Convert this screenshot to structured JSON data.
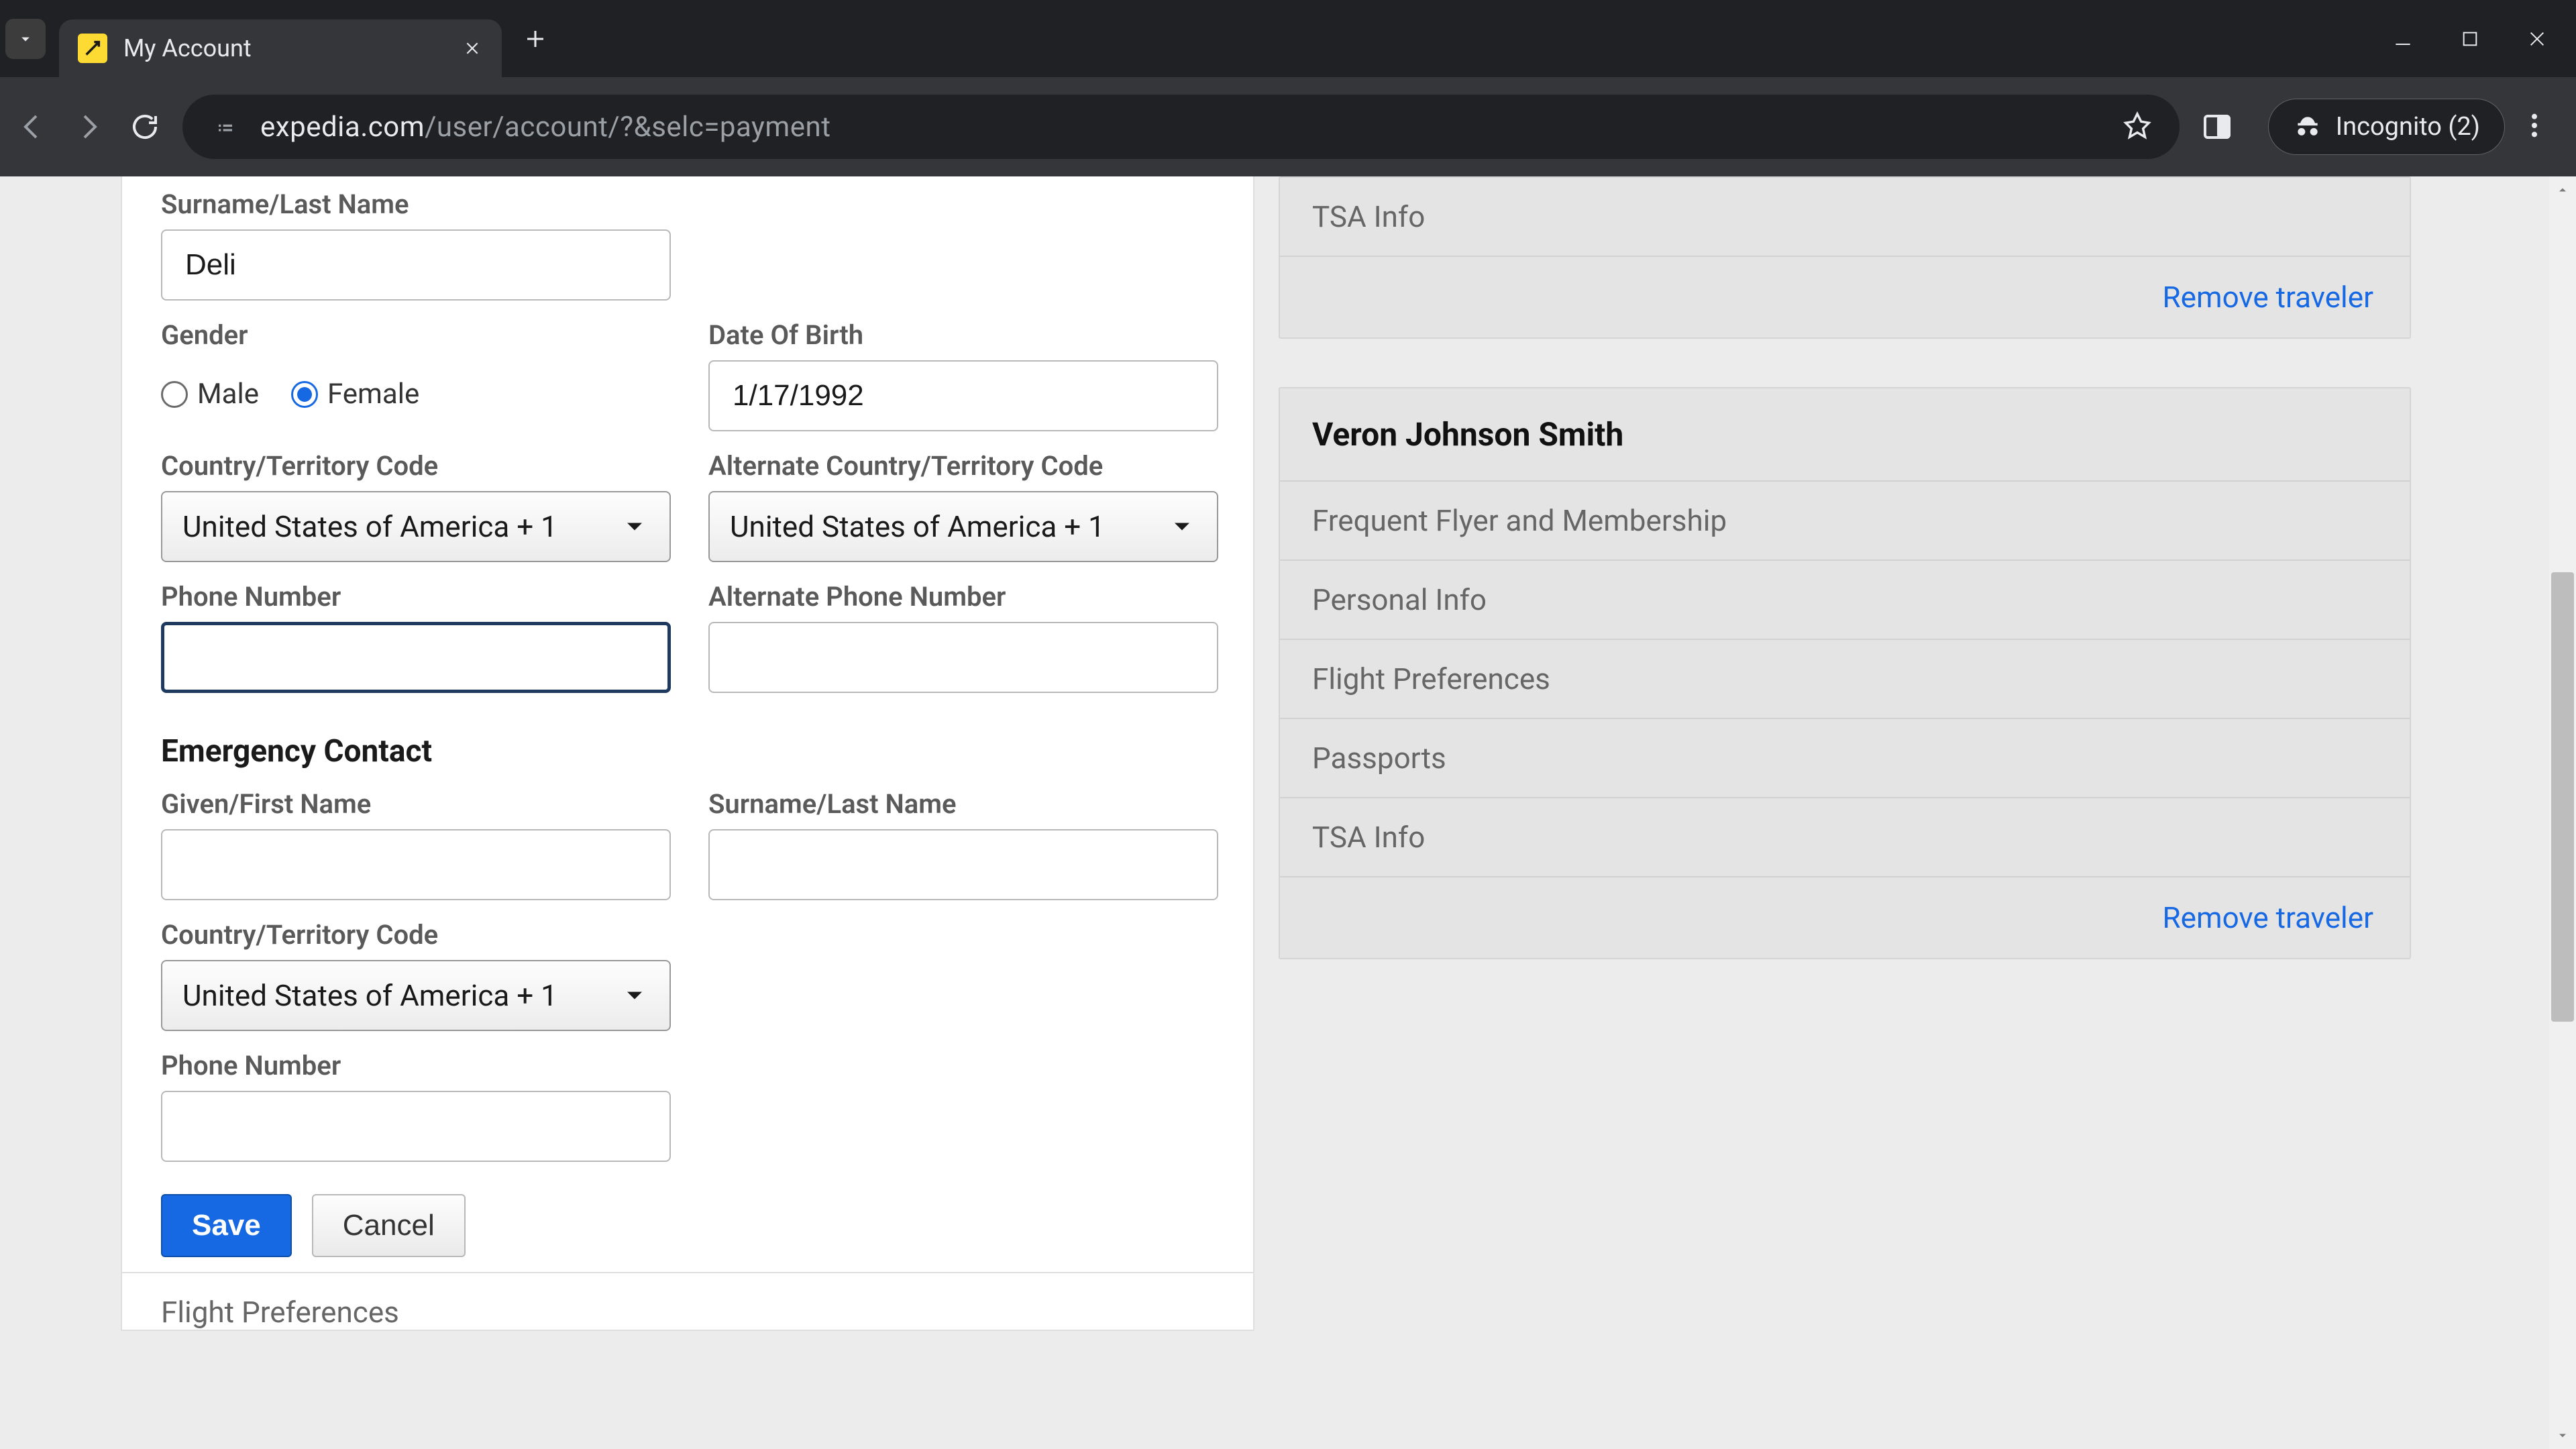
{
  "browser": {
    "tab_title": "My Account",
    "url_host": "expedia.com",
    "url_path": "/user/account/?&selc=payment",
    "incognito_label": "Incognito (2)"
  },
  "form": {
    "surname_label": "Surname/Last Name",
    "surname_value": "Deli",
    "gender_label": "Gender",
    "gender_male": "Male",
    "gender_female": "Female",
    "gender_selected": "female",
    "dob_label": "Date Of Birth",
    "dob_value": "1/17/1992",
    "country_label": "Country/Territory Code",
    "alt_country_label": "Alternate Country/Territory Code",
    "country_value": "United States of America + 1",
    "alt_country_value": "United States of America + 1",
    "phone_label": "Phone Number",
    "alt_phone_label": "Alternate Phone Number",
    "phone_value": "",
    "alt_phone_value": ""
  },
  "emergency": {
    "header": "Emergency Contact",
    "first_label": "Given/First Name",
    "last_label": "Surname/Last Name",
    "first_value": "",
    "last_value": "",
    "country_label": "Country/Territory Code",
    "country_value": "United States of America + 1",
    "phone_label": "Phone Number",
    "phone_value": ""
  },
  "buttons": {
    "save": "Save",
    "cancel": "Cancel"
  },
  "left_accordion": {
    "flight_prefs": "Flight Preferences"
  },
  "traveler1": {
    "tsa": "TSA Info",
    "remove": "Remove traveler"
  },
  "traveler2": {
    "name": "Veron Johnson Smith",
    "freq": "Frequent Flyer and Membership",
    "personal": "Personal Info",
    "flight": "Flight Preferences",
    "passports": "Passports",
    "tsa": "TSA Info",
    "remove": "Remove traveler"
  }
}
